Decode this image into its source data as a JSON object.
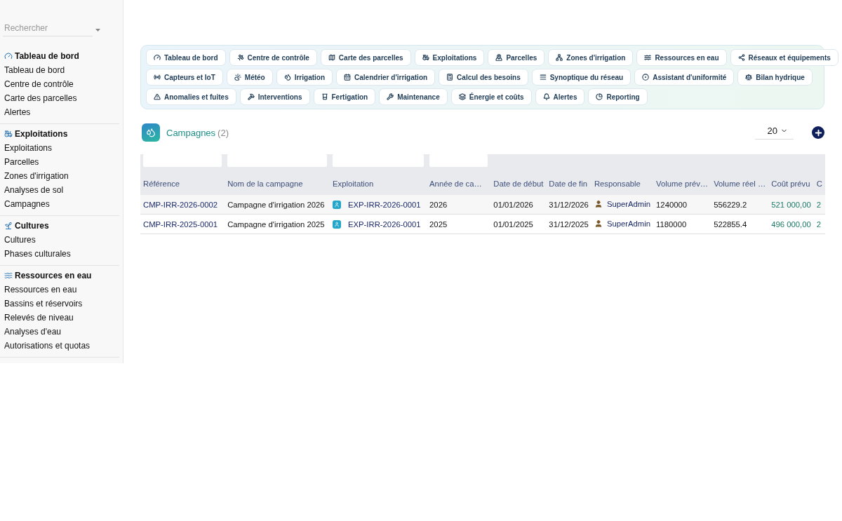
{
  "sidebar": {
    "search": {
      "placeholder": "Rechercher"
    },
    "sections": [
      {
        "title": "Tableau de bord",
        "items": [
          "Tableau de bord",
          "Centre de contrôle",
          "Carte des parcelles",
          "Alertes"
        ]
      },
      {
        "title": "Exploitations",
        "items": [
          "Exploitations",
          "Parcelles",
          "Zones d'irrigation",
          "Analyses de sol",
          "Campagnes"
        ]
      },
      {
        "title": "Cultures",
        "items": [
          "Cultures",
          "Phases culturales"
        ]
      },
      {
        "title": "Ressources en eau",
        "items": [
          "Ressources en eau",
          "Bassins et réservoirs",
          "Relevés de niveau",
          "Analyses d'eau",
          "Autorisations et quotas"
        ]
      }
    ]
  },
  "nav_chips": [
    [
      "Tableau de bord",
      "Centre de contrôle",
      "Carte des parcelles",
      "Exploitations",
      "Parcelles",
      "Zones d'irrigation",
      "Ressources en eau",
      "Réseaux et équipements"
    ],
    [
      "Capteurs et IoT",
      "Météo",
      "Irrigation",
      "Calendrier d'irrigation",
      "Calcul des besoins",
      "Synoptique du réseau",
      "Assistant d'uniformité",
      "Bilan hydrique"
    ],
    [
      "Anomalies et fuites",
      "Interventions",
      "Fertigation",
      "Maintenance",
      "Énergie et coûts",
      "Alertes",
      "Reporting"
    ]
  ],
  "list": {
    "title": "Campagnes",
    "count": "(2)",
    "page_size": "20"
  },
  "table": {
    "columns": [
      {
        "label": "Référence",
        "filter": true
      },
      {
        "label": "Nom de la campagne",
        "filter": true
      },
      {
        "label": "Exploitation",
        "filter": true
      },
      {
        "label": "Année de ca…",
        "filter": true
      },
      {
        "label": "Date de début",
        "filter": false
      },
      {
        "label": "Date de fin",
        "filter": false
      },
      {
        "label": "Responsable",
        "filter": false
      },
      {
        "label": "Volume prév…",
        "filter": false
      },
      {
        "label": "Volume réel …",
        "filter": false
      },
      {
        "label": "Coût prévu",
        "filter": false
      },
      {
        "label": "C",
        "filter": false
      }
    ],
    "rows": [
      [
        {
          "kind": "link",
          "text": "CMP-IRR-2026-0002"
        },
        {
          "kind": "text",
          "text": "Campagne d'irrigation 2026"
        },
        {
          "kind": "farm",
          "text": "EXP-IRR-2026-0001"
        },
        {
          "kind": "text",
          "text": "2026"
        },
        {
          "kind": "text",
          "text": "01/01/2026"
        },
        {
          "kind": "text",
          "text": "31/12/2026"
        },
        {
          "kind": "user",
          "text": "SuperAdmin"
        },
        {
          "kind": "text",
          "text": "1240000"
        },
        {
          "kind": "text",
          "text": "556229.2"
        },
        {
          "kind": "money",
          "text": "521 000,00"
        },
        {
          "kind": "money",
          "text": "2"
        }
      ],
      [
        {
          "kind": "link",
          "text": "CMP-IRR-2025-0001"
        },
        {
          "kind": "text",
          "text": "Campagne d'irrigation 2025"
        },
        {
          "kind": "farm",
          "text": "EXP-IRR-2026-0001"
        },
        {
          "kind": "text",
          "text": "2025"
        },
        {
          "kind": "text",
          "text": "01/01/2025"
        },
        {
          "kind": "text",
          "text": "31/12/2025"
        },
        {
          "kind": "user",
          "text": "SuperAdmin"
        },
        {
          "kind": "text",
          "text": "1180000"
        },
        {
          "kind": "text",
          "text": "522855.4"
        },
        {
          "kind": "money",
          "text": "496 000,00"
        },
        {
          "kind": "money",
          "text": "2"
        }
      ]
    ]
  }
}
